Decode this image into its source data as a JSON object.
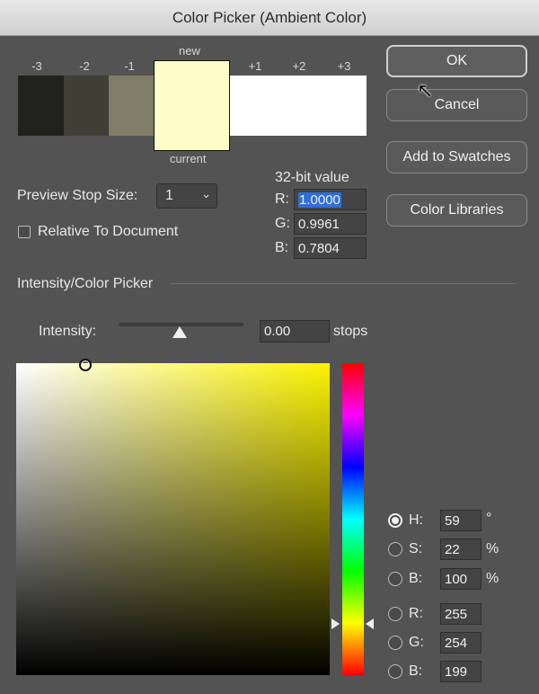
{
  "title": "Color Picker (Ambient Color)",
  "swatches": {
    "labels": [
      "-3",
      "-2",
      "-1",
      "+1",
      "+2",
      "+3"
    ],
    "new_label": "new",
    "current_label": "current",
    "colors": [
      "#22221c",
      "#3f3f35",
      "#7d7d68",
      "#fefdc7",
      "#ffffff",
      "#ffffff",
      "#ffffff"
    ]
  },
  "buttons": {
    "ok": "OK",
    "cancel": "Cancel",
    "add_to_swatches": "Add to Swatches",
    "color_libraries": "Color Libraries"
  },
  "value32": {
    "title": "32-bit value",
    "r_label": "R:",
    "r": "1.0000",
    "g_label": "G:",
    "g": "0.9961",
    "b_label": "B:",
    "b": "0.7804"
  },
  "preview": {
    "label": "Preview Stop Size:",
    "value": "1",
    "relative_label": "Relative To Document",
    "relative_checked": false
  },
  "section_title": "Intensity/Color Picker",
  "intensity": {
    "label": "Intensity:",
    "value": "0.00",
    "unit": "stops",
    "slider_fraction": 0.5
  },
  "color_fields": {
    "h": {
      "label": "H:",
      "value": "59",
      "unit": "°",
      "selected": true
    },
    "s": {
      "label": "S:",
      "value": "22",
      "unit": "%",
      "selected": false
    },
    "bright": {
      "label": "B:",
      "value": "100",
      "unit": "%",
      "selected": false
    },
    "r": {
      "label": "R:",
      "value": "255",
      "selected": false
    },
    "g": {
      "label": "G:",
      "value": "254",
      "selected": false
    },
    "b": {
      "label": "B:",
      "value": "199",
      "selected": false
    }
  },
  "colors": {
    "dialog_bg": "#535353",
    "field_bg": "#444444",
    "selected_text_bg": "#2f6fd6",
    "hue_color": "#fcf300"
  }
}
